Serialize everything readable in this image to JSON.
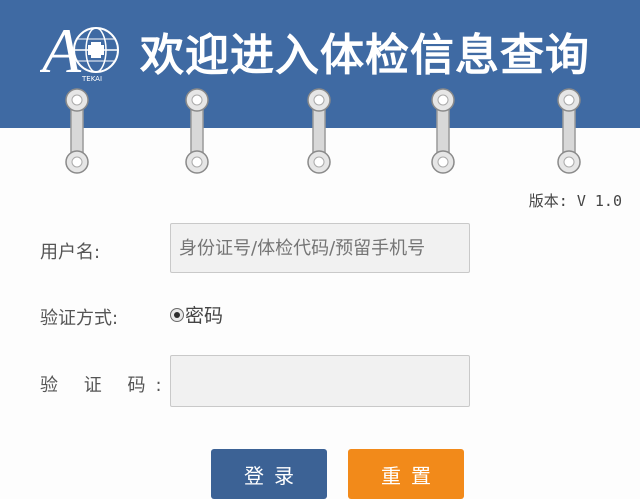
{
  "header": {
    "title": "欢迎进入体检信息查询",
    "logo": {
      "letter": "A",
      "icon": "globe-cross-logo",
      "caption": "TEKAI"
    }
  },
  "version_text": "版本: V 1.0",
  "form": {
    "username_label": "用户名:",
    "username_placeholder": "身份证号/体检代码/预留手机号",
    "method_label": "验证方式:",
    "method_option": "密码",
    "code_label": "验 证 码:",
    "code_value": ""
  },
  "buttons": {
    "login": "登录",
    "reset": "重置"
  },
  "colors": {
    "header_bg": "#3f6aa3",
    "login_bg": "#3c6295",
    "reset_bg": "#f28a1a",
    "page_bg": "#fdfdfd"
  }
}
